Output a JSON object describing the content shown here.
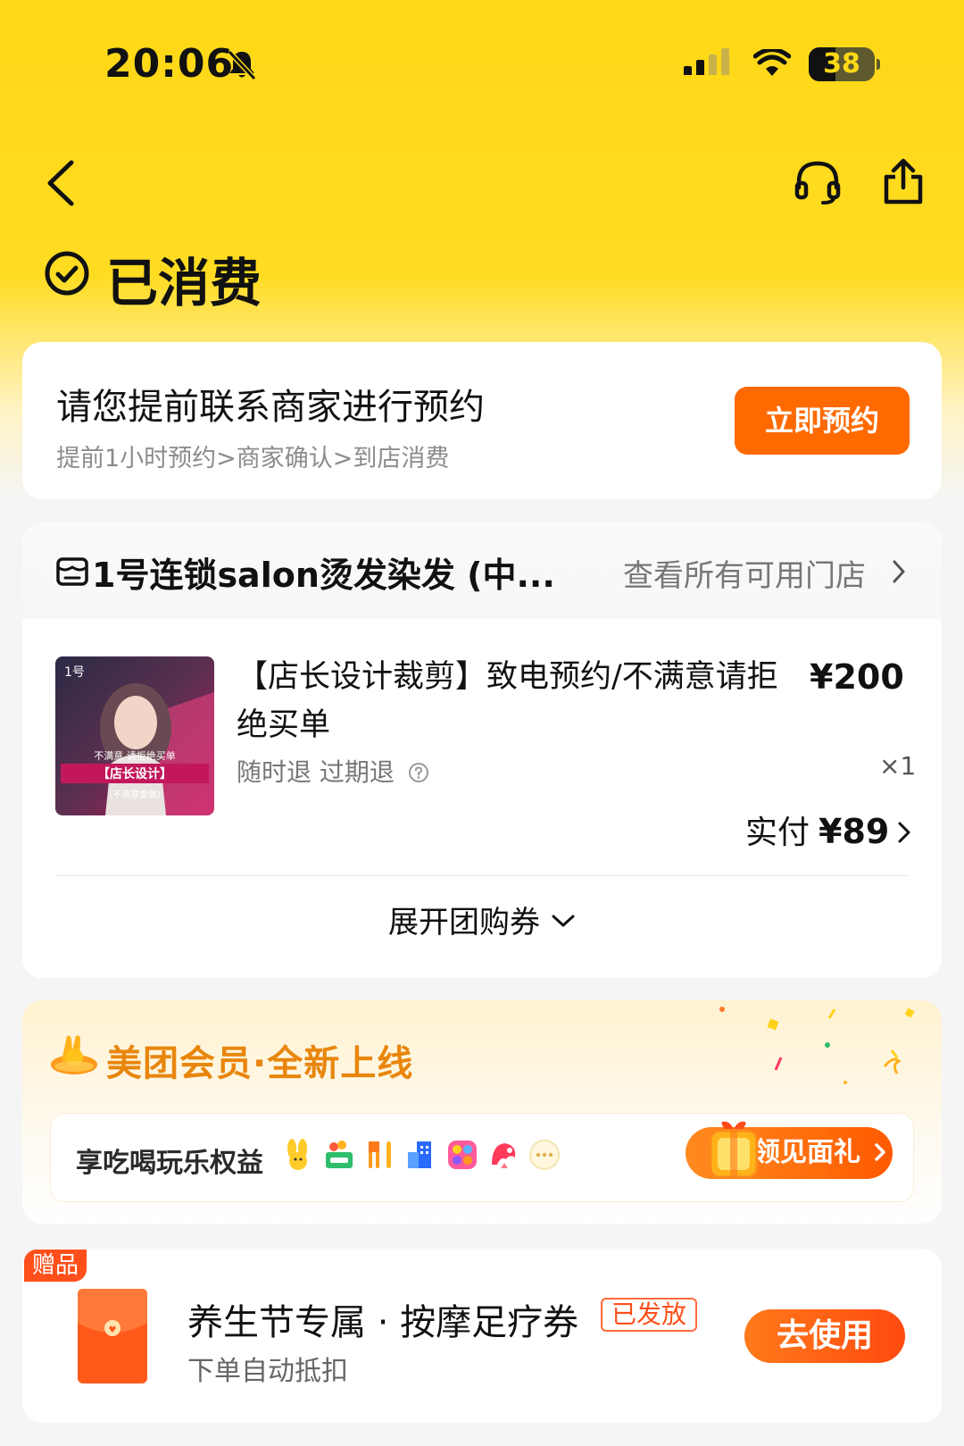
{
  "status_bar": {
    "time": "20:06",
    "battery": "38",
    "colors": {
      "header_bg": "#ffd816",
      "accent": "#ff6a00"
    }
  },
  "header": {
    "back_icon": "chevron-left-icon",
    "service_icon": "headset-icon",
    "share_icon": "share-icon",
    "status_title": "已消费",
    "status_icon": "check-circle-icon"
  },
  "appointment": {
    "title": "请您提前联系商家进行预约",
    "subtitle": "提前1小时预约>商家确认>到店消费",
    "button": "立即预约"
  },
  "order": {
    "store_name": "1号连锁salon烫发染发 (中...",
    "store_link": "查看所有可用门店",
    "product_title": "【店长设计裁剪】致电预约/不满意请拒绝买单",
    "price": "¥200",
    "tags": "随时退 过期退",
    "quantity": "×1",
    "paid_label": "实付",
    "paid_amount": "¥89",
    "expand_label": "展开团购券",
    "product_image": {
      "text_top": "不满意 请拒绝买单",
      "text_mid": "【店长设计】",
      "text_bot": "（不满意重做）"
    }
  },
  "member": {
    "title": "美团会员·全新上线",
    "benefit": "享吃喝玩乐权益",
    "benefit_icons": [
      "bunny-icon",
      "grocery-icon",
      "dining-icon",
      "hotel-icon",
      "games-icon",
      "flower-icon",
      "more-icon"
    ],
    "gift_button": "领见面礼"
  },
  "voucher": {
    "tag": "赠品",
    "title": "养生节专属 · 按摩足疗券",
    "badge": "已发放",
    "subtitle": "下单自动抵扣",
    "button": "去使用"
  }
}
